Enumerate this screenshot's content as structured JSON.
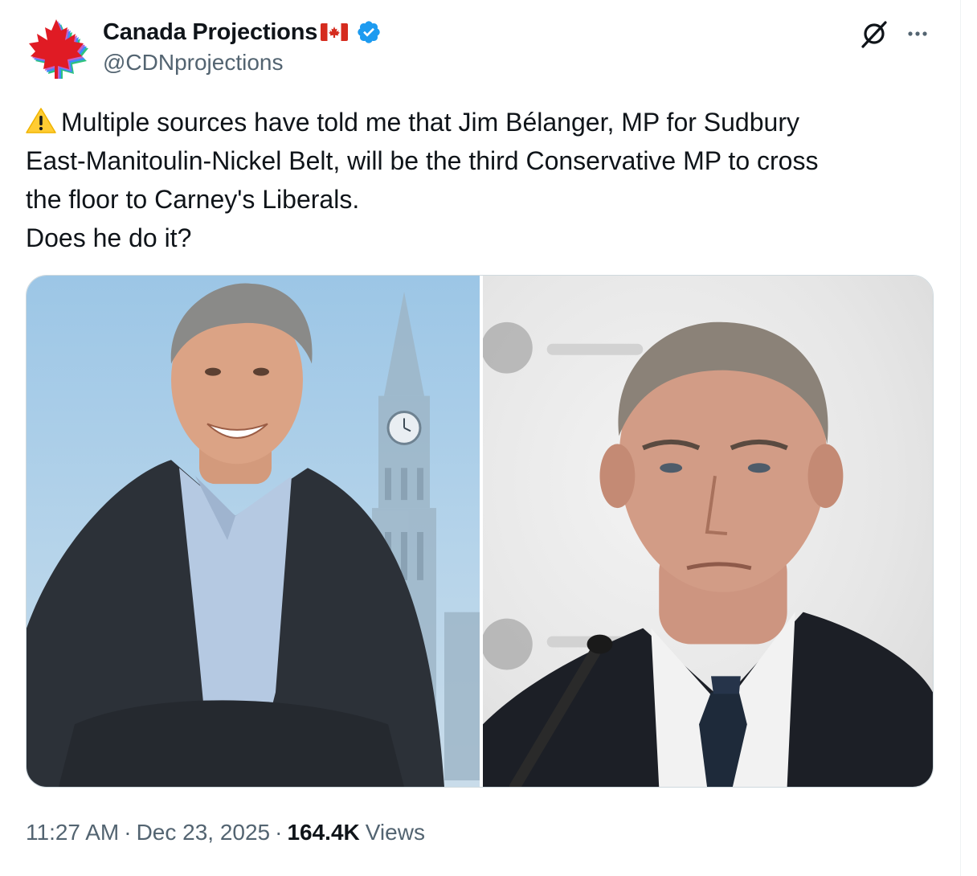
{
  "author": {
    "display_name": "Canada Projections",
    "handle": "@CDNprojections",
    "avatar_text": "Canada Projections",
    "flag_icon": "canada-flag-icon",
    "verified_icon": "verified-badge-icon",
    "verified_color": "#1d9bf0"
  },
  "actions": {
    "grok_icon": "grok-icon",
    "more_icon": "more-dots-icon"
  },
  "tweet": {
    "lines": [
      "Multiple sources have told me that Jim Bélanger, MP for Sudbury",
      "East-Manitoulin-Nickel Belt, will be the third Conservative MP to cross",
      "the floor to Carney's Liberals.",
      "Does he do it?"
    ],
    "lead_icon": "warning-icon"
  },
  "media": {
    "photos": [
      "photo-smiling-man-parliament",
      "photo-man-in-suit-microphone"
    ]
  },
  "meta": {
    "time": "11:27 AM",
    "date": "Dec 23, 2025",
    "views_count": "164.4K",
    "views_label": "Views",
    "separator": "·"
  },
  "colors": {
    "text_primary": "#0f1419",
    "text_secondary": "#536471",
    "border": "#cfd9de",
    "accent": "#1d9bf0"
  }
}
